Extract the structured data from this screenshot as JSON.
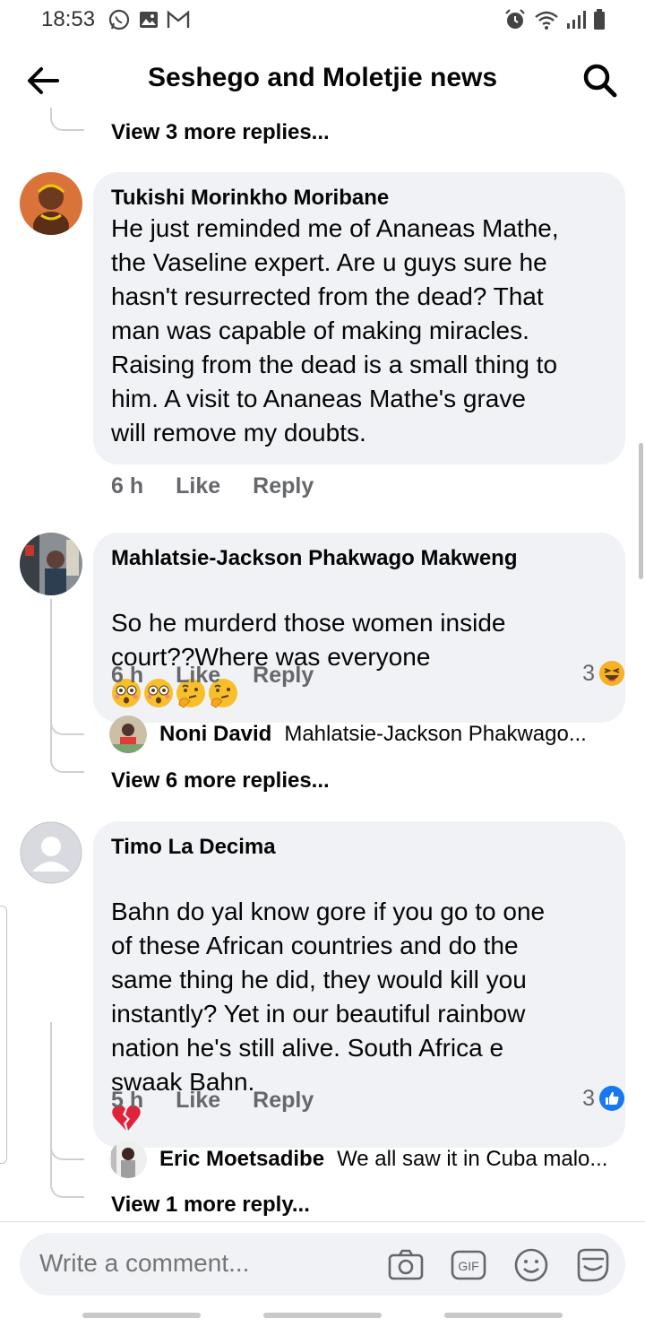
{
  "status_bar": {
    "time": "18:53",
    "left_icons": [
      "whatsapp-icon",
      "gallery-icon",
      "gmail-icon"
    ],
    "right_icons": [
      "alarm-icon",
      "wifi-icon",
      "signal-icon",
      "battery-icon"
    ]
  },
  "header": {
    "title": "Seshego and Moletjie news",
    "back_icon": "arrow-left-icon",
    "search_icon": "search-icon"
  },
  "colors": {
    "bubble_bg": "#f0f2f5",
    "secondary_text": "#65676b",
    "like_blue": "#1877f2",
    "haha_yellow": "#f7b125"
  },
  "thread": {
    "top_view_more": "View 3 more replies...",
    "comments": [
      {
        "author": "Tukishi Morinkho Moribane",
        "text": "He just reminded me of Ananeas Mathe,\nthe Vaseline expert. Are u guys sure he\nhasn't resurrected from the dead? That\nman was capable of making miracles.\nRaising from the dead is a small thing to\nhim. A  visit to Ananeas Mathe's grave\nwill remove my doubts.",
        "time": "6 h",
        "like_label": "Like",
        "reply_label": "Reply"
      },
      {
        "author": "Mahlatsie-Jackson Phakwago Makweng",
        "text": "So he murderd those women inside\ncourt??Where was everyone",
        "emojis": [
          "flushed-face",
          "flushed-face",
          "thinking-face",
          "thinking-face"
        ],
        "time": "6 h",
        "like_label": "Like",
        "reply_label": "Reply",
        "reaction_count": "3",
        "reaction_icon": "haha-reaction-icon",
        "reply_preview": {
          "name": "Noni David",
          "snippet": "Mahlatsie-Jackson Phakwago..."
        },
        "view_more": "View 6 more replies..."
      },
      {
        "author": "Timo La Decima",
        "text": "Bahn do yal know gore if you go to one\nof these African countries and do the\nsame thing he did, they would kill you\ninstantly? Yet in our beautiful rainbow\nnation he's still alive. South Africa e\nswaak Bahn.",
        "emojis": [
          "broken-heart"
        ],
        "time": "5 h",
        "like_label": "Like",
        "reply_label": "Reply",
        "reaction_count": "3",
        "reaction_icon": "like-reaction-icon",
        "reply_preview": {
          "name": "Eric Moetsadibe",
          "snippet": "We all saw it in Cuba malo..."
        },
        "view_more": "View 1 more reply..."
      }
    ]
  },
  "composer": {
    "placeholder": "Write a comment...",
    "icons": [
      "camera-icon",
      "gif-icon",
      "emoji-icon",
      "sticker-icon"
    ]
  }
}
